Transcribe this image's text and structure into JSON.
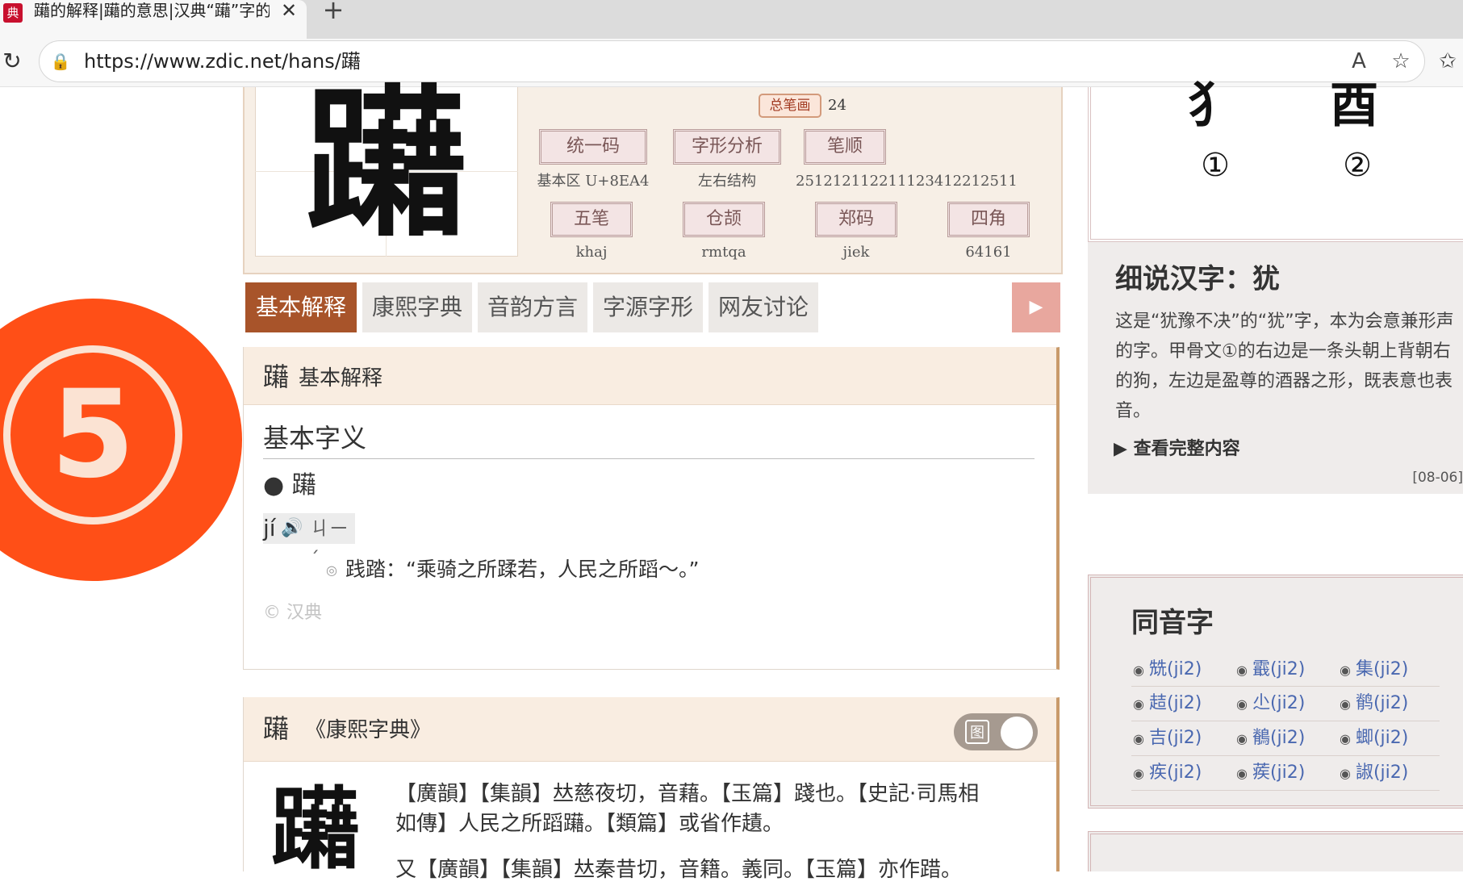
{
  "browser": {
    "tab_title": "躤的解释|躤的意思|汉典“躤”字的基",
    "favicon_glyph": "典",
    "close_glyph": "✕",
    "newtab_glyph": "+",
    "reload_glyph": "↻",
    "lock_glyph": "🔒",
    "url": "https://www.zdic.net/hans/躤",
    "read_aloud_glyph": "A",
    "favorite_glyph": "☆",
    "favorites_glyph": "✩"
  },
  "character": {
    "glyph": "躤",
    "strokes_label": "总笔画",
    "strokes_value": "24",
    "attrs": [
      {
        "label": "统一码",
        "value": "基本区 U+8EA4"
      },
      {
        "label": "字形分析",
        "value": "左右结构"
      },
      {
        "label": "笔顺",
        "value": "251212112211123412212511"
      },
      {
        "label": "五笔",
        "value": "khaj"
      },
      {
        "label": "仓颉",
        "value": "rmtqa"
      },
      {
        "label": "郑码",
        "value": "jiek"
      },
      {
        "label": "四角",
        "value": "64161"
      }
    ]
  },
  "tabs": [
    {
      "label": "基本解释",
      "active": true
    },
    {
      "label": "康熙字典",
      "active": false
    },
    {
      "label": "音韵方言",
      "active": false
    },
    {
      "label": "字源字形",
      "active": false
    },
    {
      "label": "网友讨论",
      "active": false
    }
  ],
  "tab_arrow_glyph": "▶",
  "basic": {
    "head_char": "躤",
    "head_title": "基本解释",
    "subtitle": "基本字义",
    "bullet": "● 躤",
    "pinyin": "jí",
    "speaker_glyph": "🔊",
    "zhuyin": "ㄐㄧˊ",
    "sense_marker": "◎",
    "sense": "践踏：“乘骑之所蹂若，人民之所蹈～。”",
    "copyright": "© 汉典"
  },
  "kangxi": {
    "head_char": "躤",
    "head_title": "《康熙字典》",
    "toggle_icon": "图",
    "big_char": "躤",
    "lines": [
      "【廣韻】【集韻】𠀤慈夜切，音藉。【玉篇】踐也。【史記·司馬相",
      "如傳】人民之所蹈躤。【類篇】或省作䟄。",
      "又【廣韻】【集韻】𠀤秦昔切，音籍。義同。【玉篇】亦作踖。"
    ]
  },
  "sidebar": {
    "oracle_glyphs": [
      "犭",
      "酉"
    ],
    "oracle_numbers": [
      "①",
      "②"
    ],
    "info_title": "细说汉字：犹",
    "info_desc": "这是“犹豫不决”的“犹”字，本为会意兼形声的字。甲骨文①的右边是一条头朝上背朝右的狗，左边是盈尊的酒器之形，既表意也表音。",
    "info_more": "▶ 查看完整内容",
    "info_date": "[08-06]",
    "homophones_title": "同音字",
    "homophone_marker": "◉",
    "homophones": [
      "兟(ji2)",
      "霵(ji2)",
      "集(ji2)",
      "趌(ji2)",
      "尐(ji2)",
      "鹡(ji2)",
      "吉(ji2)",
      "鶺(ji2)",
      "蝍(ji2)",
      "疾(ji2)",
      "蒺(ji2)",
      "諔(ji2)"
    ]
  },
  "overlay": {
    "number": "5"
  }
}
